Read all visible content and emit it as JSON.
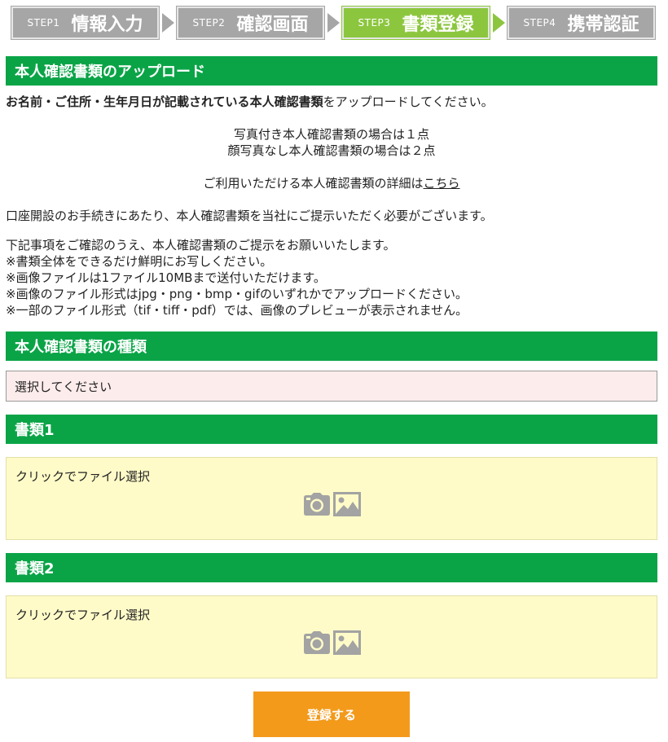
{
  "steps": [
    {
      "num": "STEP1",
      "name": "情報入力",
      "active": false
    },
    {
      "num": "STEP2",
      "name": "確認画面",
      "active": false
    },
    {
      "num": "STEP3",
      "name": "書類登録",
      "active": true
    },
    {
      "num": "STEP4",
      "name": "携帯認証",
      "active": false
    }
  ],
  "upload_section": {
    "title": "本人確認書類のアップロード",
    "line1_bold_a": "お名前・ご住所・生年月日が記載されている",
    "line1_bold_b": "本人確認書類",
    "line1_rest": "をアップロードしてください。",
    "photo_one": "写真付き本人確認書類の場合は１点",
    "photo_two": "顔写真なし本人確認書類の場合は２点",
    "details_text": "ご利用いただける本人確認書類の詳細は",
    "details_link": "こちら",
    "need_text": "口座開設のお手続きにあたり、本人確認書類を当社にご提示いただく必要がございます。",
    "notes": [
      "下記事項をご確認のうえ、本人確認書類のご提示をお願いいたします。",
      "※書類全体をできるだけ鮮明にお写しください。",
      "※画像ファイルは1ファイル10MBまで送付いただけます。",
      "※画像のファイル形式はjpg・png・bmp・gifのいずれかでアップロードください。",
      "※一部のファイル形式（tif・tiff・pdf）では、画像のプレビューが表示されません。"
    ]
  },
  "doc_type": {
    "title": "本人確認書類の種類",
    "selected": "選択してください"
  },
  "doc1": {
    "title": "書類1",
    "prompt": "クリックでファイル選択"
  },
  "doc2": {
    "title": "書類2",
    "prompt": "クリックでファイル選択"
  },
  "submit_label": "登録する",
  "icons": {
    "camera": "camera-icon",
    "image": "image-icon"
  },
  "colors": {
    "green_header": "#0aa447",
    "step_active": "#8cc63f",
    "step_inactive": "#a6a6a6",
    "upload_bg": "#fffbc8",
    "select_bg": "#fdecec",
    "button": "#f39a1b"
  }
}
